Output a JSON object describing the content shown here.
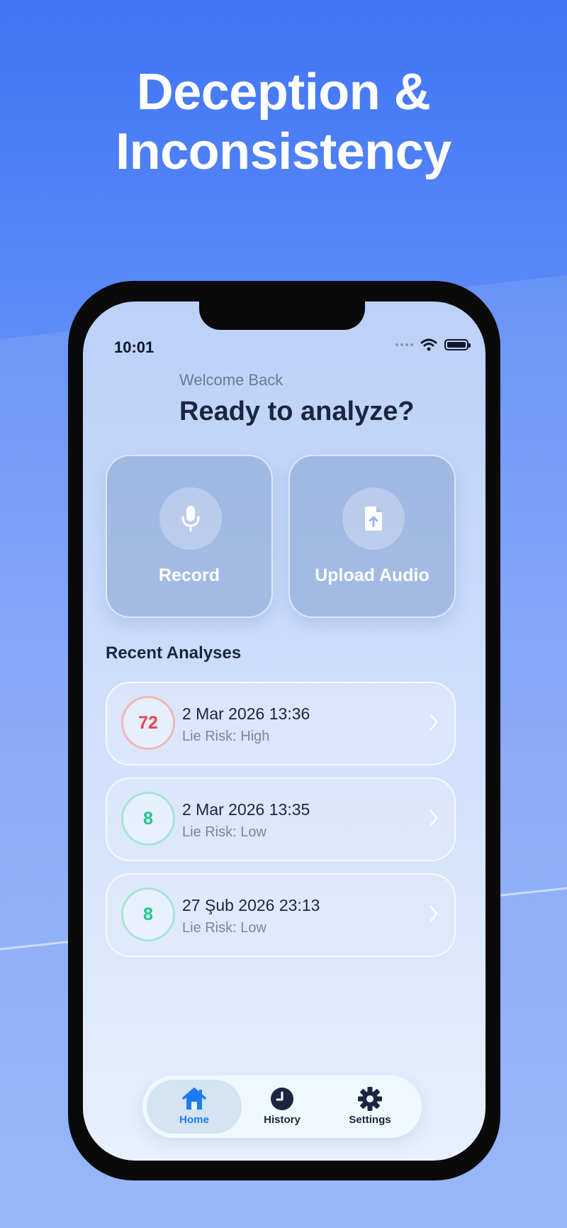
{
  "headline": {
    "line1": "Deception &",
    "line2": "Inconsistency"
  },
  "status_bar": {
    "time": "10:01"
  },
  "header": {
    "welcome": "Welcome Back",
    "title": "Ready to analyze?"
  },
  "actions": [
    {
      "label": "Record",
      "icon": "microphone-icon"
    },
    {
      "label": "Upload Audio",
      "icon": "file-upload-icon"
    }
  ],
  "recent": {
    "title": "Recent Analyses",
    "items": [
      {
        "score": "72",
        "date": "2 Mar 2026 13:36",
        "risk": "Lie Risk: High",
        "level": "high"
      },
      {
        "score": "8",
        "date": "2 Mar 2026 13:35",
        "risk": "Lie Risk: Low",
        "level": "low"
      },
      {
        "score": "8",
        "date": "27 Şub 2026 23:13",
        "risk": "Lie Risk: Low",
        "level": "low"
      }
    ]
  },
  "tabbar": {
    "tabs": [
      {
        "label": "Home",
        "icon": "home-icon",
        "active": true
      },
      {
        "label": "History",
        "icon": "clock-icon",
        "active": false
      },
      {
        "label": "Settings",
        "icon": "gear-icon",
        "active": false
      }
    ]
  },
  "colors": {
    "accent": "#1e7cf2",
    "high_risk": "#ef4452",
    "low_risk": "#1fc68d",
    "background": "#4a7cf6"
  }
}
